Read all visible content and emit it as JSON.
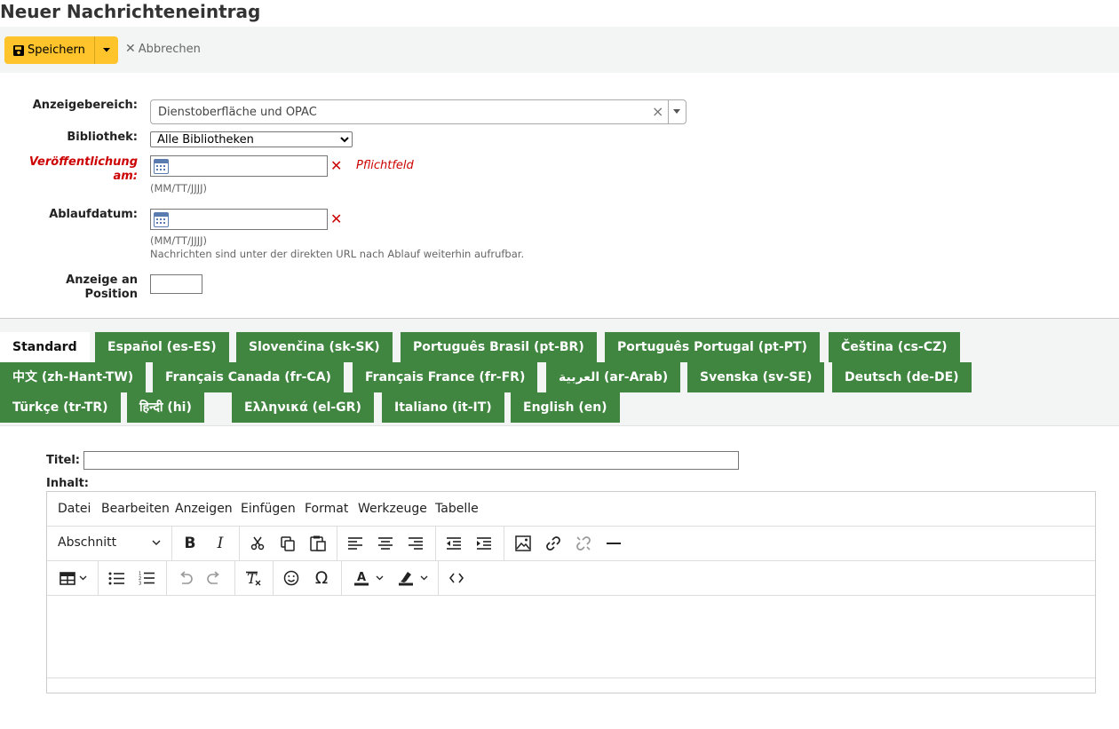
{
  "page": {
    "title": "Neuer Nachrichteneintrag"
  },
  "toolbar": {
    "save_label": "Speichern",
    "cancel_label": "Abbrechen"
  },
  "form": {
    "display_area_label": "Anzeigebereich:",
    "display_area_value": "Dienstoberfläche und OPAC",
    "library_label": "Bibliothek:",
    "library_value": "Alle Bibliotheken",
    "publish_label_line1": "Veröffentlichung",
    "publish_label_line2": "am:",
    "required_text": "Pflichtfeld",
    "date_format_hint": "(MM/TT/JJJJ)",
    "expiry_label": "Ablaufdatum:",
    "expiry_note": "Nachrichten sind unter der direkten URL nach Ablauf weiterhin aufrufbar.",
    "position_label_line1": "Anzeige an",
    "position_label_line2": "Position"
  },
  "tabs": [
    "Standard",
    "Español (es-ES)",
    "Slovenčina (sk-SK)",
    "Português Brasil (pt-BR)",
    "Português Portugal (pt-PT)",
    "Čeština (cs-CZ)",
    "中文 (zh-Hant-TW)",
    "Français Canada (fr-CA)",
    "Français France (fr-FR)",
    "العربية (ar-Arab)",
    "Svenska (sv-SE)",
    "Deutsch (de-DE)",
    "Türkçe (tr-TR)",
    "हिन्दी (hi)",
    "Ελληνικά (el-GR)",
    "Italiano (it-IT)",
    "English (en)"
  ],
  "editor": {
    "title_label": "Titel:",
    "content_label": "Inhalt:",
    "menus": [
      "Datei",
      "Bearbeiten",
      "Anzeigen",
      "Einfügen",
      "Format",
      "Werkzeuge",
      "Tabelle"
    ],
    "block_format": "Abschnitt"
  },
  "colors": {
    "save_button": "#ffc32b",
    "tab_bg": "#408540",
    "required": "#cc0000"
  }
}
